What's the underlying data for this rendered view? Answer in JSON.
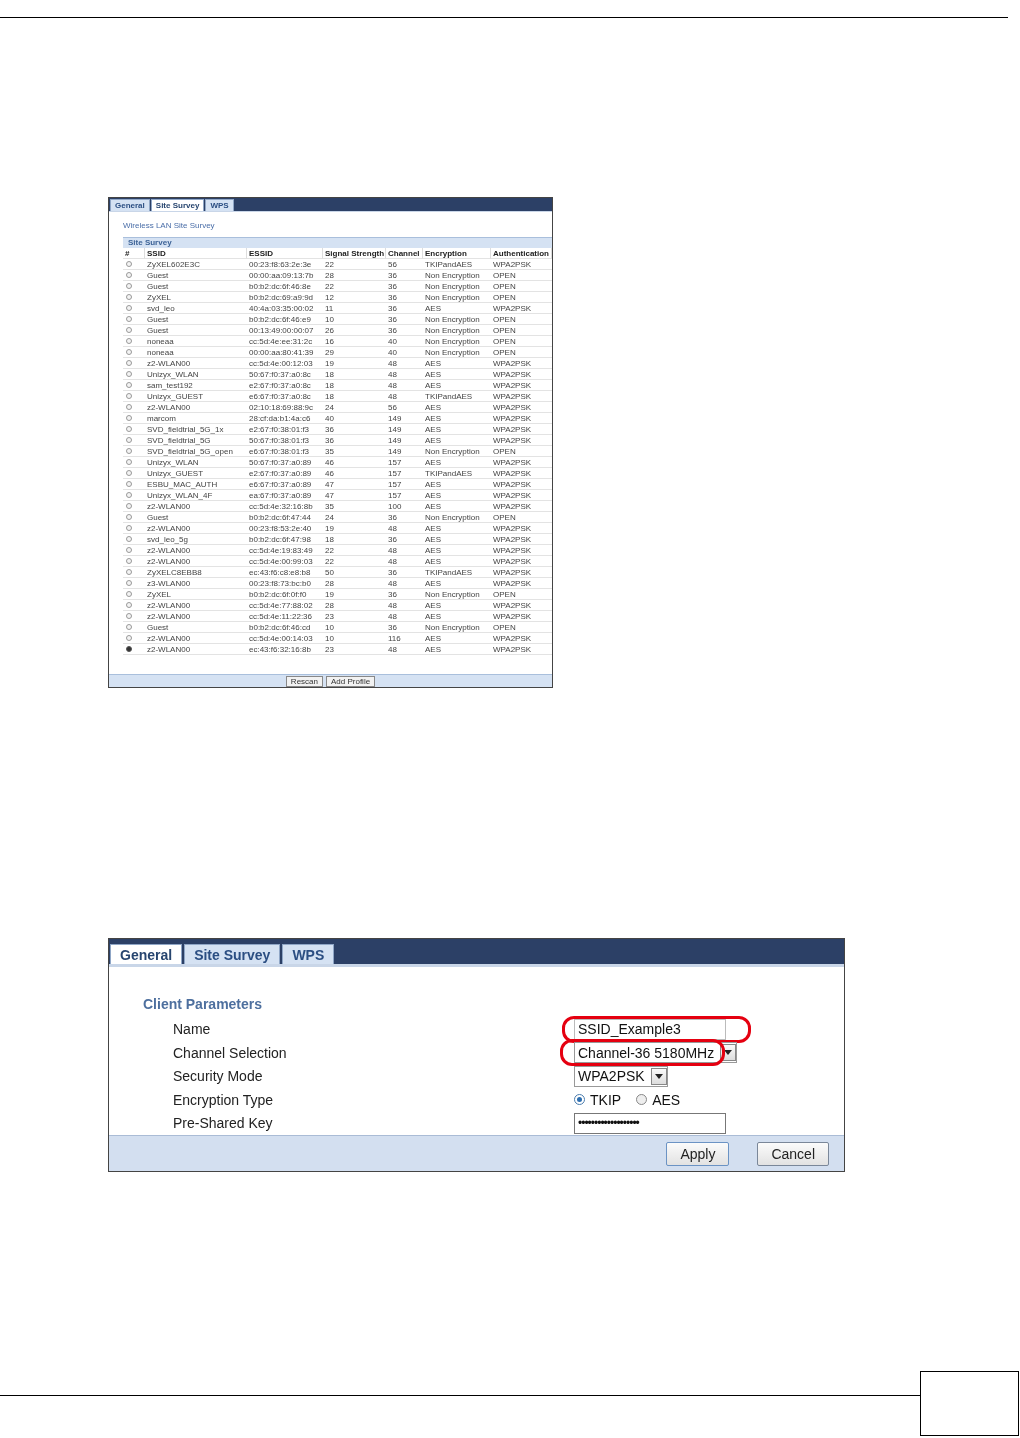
{
  "site_survey_screen": {
    "tabs": [
      {
        "label": "General",
        "selected": false
      },
      {
        "label": "Site Survey",
        "selected": true
      },
      {
        "label": "WPS",
        "selected": false
      }
    ],
    "title": "Wireless LAN Site Survey",
    "section": "Site Survey",
    "columns": [
      "#",
      "SSID",
      "ESSID",
      "Signal Strength",
      "Channel",
      "Encryption",
      "Authentication"
    ],
    "rows": [
      {
        "selected": false,
        "ssid": "ZyXEL602E3C",
        "essid": "00:23:f8:63:2e:3e",
        "signal": "22",
        "channel": "56",
        "encryption": "TKIPandAES",
        "authentication": "WPA2PSK"
      },
      {
        "selected": false,
        "ssid": "Guest",
        "essid": "00:00:aa:09:13:7b",
        "signal": "28",
        "channel": "36",
        "encryption": "Non Encryption",
        "authentication": "OPEN"
      },
      {
        "selected": false,
        "ssid": "Guest",
        "essid": "b0:b2:dc:6f:46:8e",
        "signal": "22",
        "channel": "36",
        "encryption": "Non Encryption",
        "authentication": "OPEN"
      },
      {
        "selected": false,
        "ssid": "ZyXEL",
        "essid": "b0:b2:dc:69:a9:9d",
        "signal": "12",
        "channel": "36",
        "encryption": "Non Encryption",
        "authentication": "OPEN"
      },
      {
        "selected": false,
        "ssid": "svd_leo",
        "essid": "40:4a:03:35:00:02",
        "signal": "11",
        "channel": "36",
        "encryption": "AES",
        "authentication": "WPA2PSK"
      },
      {
        "selected": false,
        "ssid": "Guest",
        "essid": "b0:b2:dc:6f:46:e9",
        "signal": "10",
        "channel": "36",
        "encryption": "Non Encryption",
        "authentication": "OPEN"
      },
      {
        "selected": false,
        "ssid": "Guest",
        "essid": "00:13:49:00:00:07",
        "signal": "26",
        "channel": "36",
        "encryption": "Non Encryption",
        "authentication": "OPEN"
      },
      {
        "selected": false,
        "ssid": "noneaa",
        "essid": "cc:5d:4e:ee:31:2c",
        "signal": "16",
        "channel": "40",
        "encryption": "Non Encryption",
        "authentication": "OPEN"
      },
      {
        "selected": false,
        "ssid": "noneaa",
        "essid": "00:00:aa:80:41:39",
        "signal": "29",
        "channel": "40",
        "encryption": "Non Encryption",
        "authentication": "OPEN"
      },
      {
        "selected": false,
        "ssid": "z2-WLAN00",
        "essid": "cc:5d:4e:00:12:03",
        "signal": "19",
        "channel": "48",
        "encryption": "AES",
        "authentication": "WPA2PSK"
      },
      {
        "selected": false,
        "ssid": "Unizyx_WLAN",
        "essid": "50:67:f0:37:a0:8c",
        "signal": "18",
        "channel": "48",
        "encryption": "AES",
        "authentication": "WPA2PSK"
      },
      {
        "selected": false,
        "ssid": "sam_test192",
        "essid": "e2:67:f0:37:a0:8c",
        "signal": "18",
        "channel": "48",
        "encryption": "AES",
        "authentication": "WPA2PSK"
      },
      {
        "selected": false,
        "ssid": "Unizyx_GUEST",
        "essid": "e6:67:f0:37:a0:8c",
        "signal": "18",
        "channel": "48",
        "encryption": "TKIPandAES",
        "authentication": "WPA2PSK"
      },
      {
        "selected": false,
        "ssid": "z2-WLAN00",
        "essid": "02:10:18:69:88:9c",
        "signal": "24",
        "channel": "56",
        "encryption": "AES",
        "authentication": "WPA2PSK"
      },
      {
        "selected": false,
        "ssid": "marcom",
        "essid": "28:cf:da:b1:4a:c6",
        "signal": "40",
        "channel": "149",
        "encryption": "AES",
        "authentication": "WPA2PSK"
      },
      {
        "selected": false,
        "ssid": "SVD_fieldtrial_5G_1x",
        "essid": "e2:67:f0:38:01:f3",
        "signal": "36",
        "channel": "149",
        "encryption": "AES",
        "authentication": "WPA2PSK"
      },
      {
        "selected": false,
        "ssid": "SVD_fieldtrial_5G",
        "essid": "50:67:f0:38:01:f3",
        "signal": "36",
        "channel": "149",
        "encryption": "AES",
        "authentication": "WPA2PSK"
      },
      {
        "selected": false,
        "ssid": "SVD_fieldtrial_5G_open",
        "essid": "e6:67:f0:38:01:f3",
        "signal": "35",
        "channel": "149",
        "encryption": "Non Encryption",
        "authentication": "OPEN"
      },
      {
        "selected": false,
        "ssid": "Unizyx_WLAN",
        "essid": "50:67:f0:37:a0:89",
        "signal": "46",
        "channel": "157",
        "encryption": "AES",
        "authentication": "WPA2PSK"
      },
      {
        "selected": false,
        "ssid": "Unizyx_GUEST",
        "essid": "e2:67:f0:37:a0:89",
        "signal": "46",
        "channel": "157",
        "encryption": "TKIPandAES",
        "authentication": "WPA2PSK"
      },
      {
        "selected": false,
        "ssid": "ESBU_MAC_AUTH",
        "essid": "e6:67:f0:37:a0:89",
        "signal": "47",
        "channel": "157",
        "encryption": "AES",
        "authentication": "WPA2PSK"
      },
      {
        "selected": false,
        "ssid": "Unizyx_WLAN_4F",
        "essid": "ea:67:f0:37:a0:89",
        "signal": "47",
        "channel": "157",
        "encryption": "AES",
        "authentication": "WPA2PSK"
      },
      {
        "selected": false,
        "ssid": "z2-WLAN00",
        "essid": "cc:5d:4e:32:16:8b",
        "signal": "35",
        "channel": "100",
        "encryption": "AES",
        "authentication": "WPA2PSK"
      },
      {
        "selected": false,
        "ssid": "Guest",
        "essid": "b0:b2:dc:6f:47:44",
        "signal": "24",
        "channel": "36",
        "encryption": "Non Encryption",
        "authentication": "OPEN"
      },
      {
        "selected": false,
        "ssid": "z2-WLAN00",
        "essid": "00:23:f8:53:2e:40",
        "signal": "19",
        "channel": "48",
        "encryption": "AES",
        "authentication": "WPA2PSK"
      },
      {
        "selected": false,
        "ssid": "svd_leo_5g",
        "essid": "b0:b2:dc:6f:47:98",
        "signal": "18",
        "channel": "36",
        "encryption": "AES",
        "authentication": "WPA2PSK"
      },
      {
        "selected": false,
        "ssid": "z2-WLAN00",
        "essid": "cc:5d:4e:19:83:49",
        "signal": "22",
        "channel": "48",
        "encryption": "AES",
        "authentication": "WPA2PSK"
      },
      {
        "selected": false,
        "ssid": "z2-WLAN00",
        "essid": "cc:5d:4e:00:99:03",
        "signal": "22",
        "channel": "48",
        "encryption": "AES",
        "authentication": "WPA2PSK"
      },
      {
        "selected": false,
        "ssid": "ZyXELC8EBB8",
        "essid": "ec:43:f6:c8:e8:b8",
        "signal": "50",
        "channel": "36",
        "encryption": "TKIPandAES",
        "authentication": "WPA2PSK"
      },
      {
        "selected": false,
        "ssid": "z3-WLAN00",
        "essid": "00:23:f8:73:bc:b0",
        "signal": "28",
        "channel": "48",
        "encryption": "AES",
        "authentication": "WPA2PSK"
      },
      {
        "selected": false,
        "ssid": "ZyXEL",
        "essid": "b0:b2:dc:6f:0f:f0",
        "signal": "19",
        "channel": "36",
        "encryption": "Non Encryption",
        "authentication": "OPEN"
      },
      {
        "selected": false,
        "ssid": "z2-WLAN00",
        "essid": "cc:5d:4e:77:88:02",
        "signal": "28",
        "channel": "48",
        "encryption": "AES",
        "authentication": "WPA2PSK"
      },
      {
        "selected": false,
        "ssid": "z2-WLAN00",
        "essid": "cc:5d:4e:11:22:36",
        "signal": "23",
        "channel": "48",
        "encryption": "AES",
        "authentication": "WPA2PSK"
      },
      {
        "selected": false,
        "ssid": "Guest",
        "essid": "b0:b2:dc:6f:46:cd",
        "signal": "10",
        "channel": "36",
        "encryption": "Non Encryption",
        "authentication": "OPEN"
      },
      {
        "selected": false,
        "ssid": "z2-WLAN00",
        "essid": "cc:5d:4e:00:14:03",
        "signal": "10",
        "channel": "116",
        "encryption": "AES",
        "authentication": "WPA2PSK"
      },
      {
        "selected": true,
        "ssid": "z2-WLAN00",
        "essid": "ec:43:f6:32:16:8b",
        "signal": "23",
        "channel": "48",
        "encryption": "AES",
        "authentication": "WPA2PSK"
      }
    ],
    "buttons": [
      "Rescan",
      "Add Profile"
    ]
  },
  "client_screen": {
    "tabs": [
      {
        "label": "General",
        "selected": true
      },
      {
        "label": "Site Survey",
        "selected": false
      },
      {
        "label": "WPS",
        "selected": false
      }
    ],
    "section": "Client Parameters",
    "fields": [
      {
        "kind": "text",
        "label": "Name",
        "value": "SSID_Example3",
        "highlighted": true
      },
      {
        "kind": "select",
        "label": "Channel Selection",
        "value": "Channel-36 5180MHz",
        "highlighted": true
      },
      {
        "kind": "select",
        "label": "Security Mode",
        "value": "WPA2PSK",
        "highlighted": false
      },
      {
        "kind": "radio",
        "label": "Encryption Type",
        "options": [
          {
            "label": "TKIP",
            "selected": true
          },
          {
            "label": "AES",
            "selected": false
          }
        ]
      },
      {
        "kind": "password",
        "label": "Pre-Shared Key",
        "value": "•••••••••••••••••••"
      }
    ],
    "buttons": [
      "Apply",
      "Cancel"
    ]
  }
}
